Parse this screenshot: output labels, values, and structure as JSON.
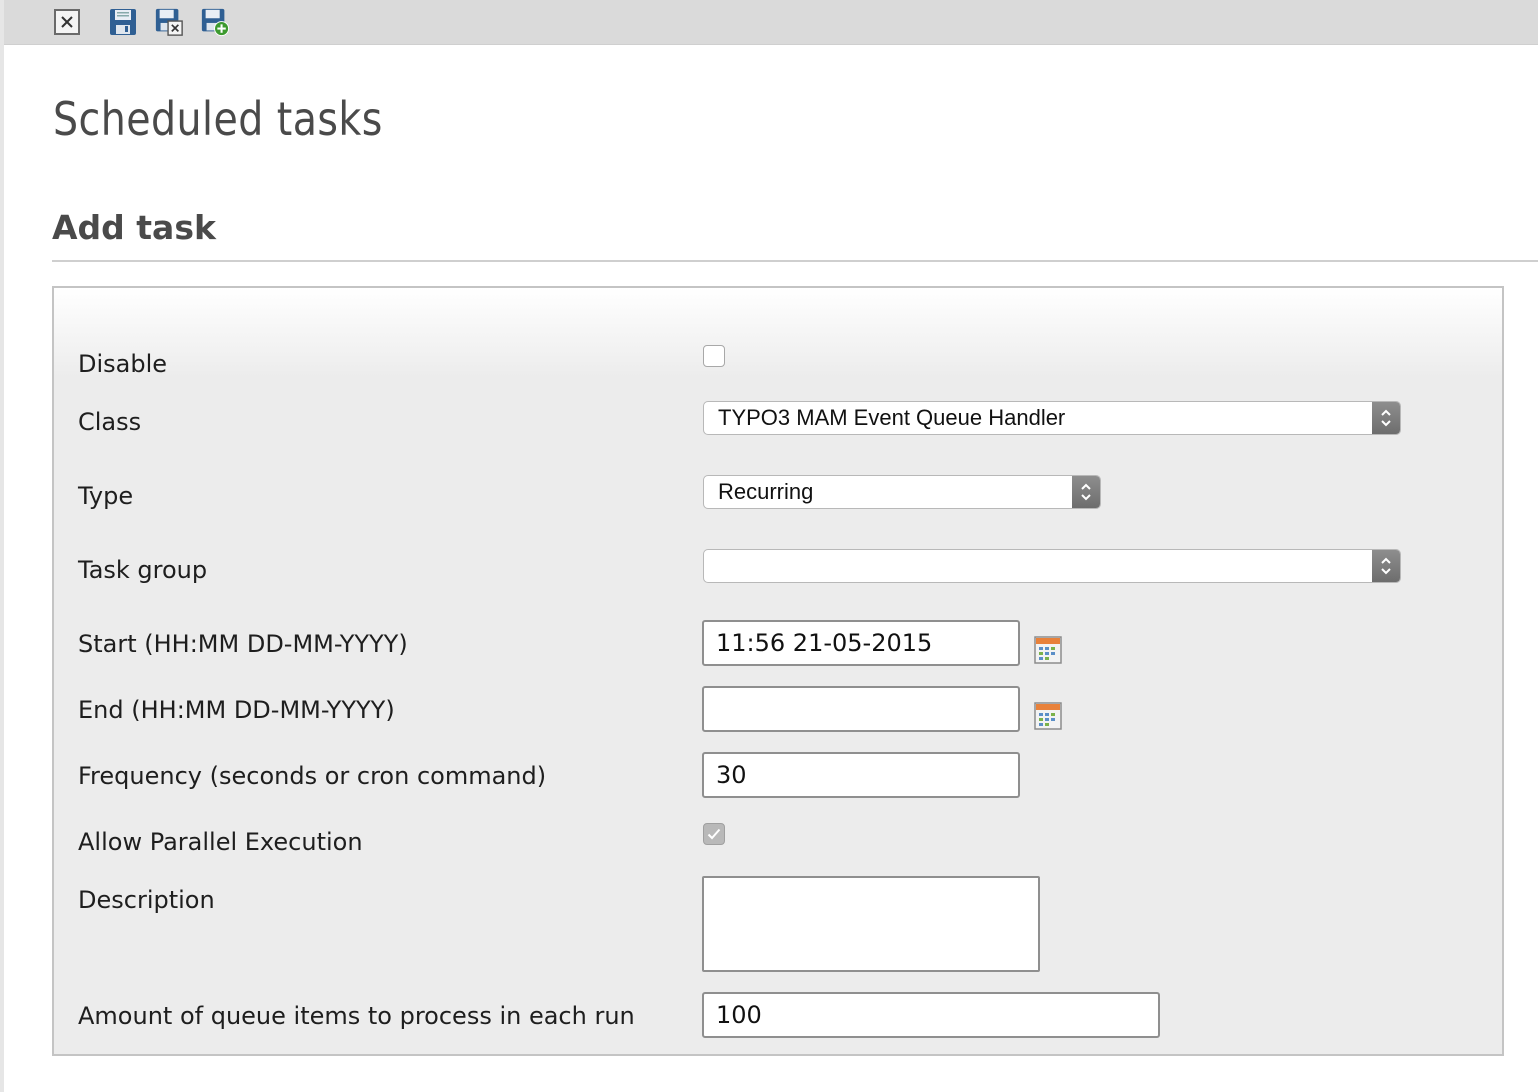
{
  "toolbar": {
    "buttons": [
      {
        "name": "close-button",
        "icon": "close-document-icon"
      },
      {
        "name": "save-button",
        "icon": "save-icon"
      },
      {
        "name": "save-and-close-button",
        "icon": "save-close-icon"
      },
      {
        "name": "save-and-new-button",
        "icon": "save-new-icon"
      }
    ]
  },
  "page": {
    "title": "Scheduled tasks",
    "section_title": "Add task"
  },
  "form": {
    "disable": {
      "label": "Disable",
      "checked": false
    },
    "class": {
      "label": "Class",
      "value": "TYPO3 MAM Event Queue Handler"
    },
    "type": {
      "label": "Type",
      "value": "Recurring"
    },
    "task_group": {
      "label": "Task group",
      "value": ""
    },
    "start": {
      "label": "Start (HH:MM DD-MM-YYYY)",
      "value": "11:56 21-05-2015"
    },
    "end": {
      "label": "End (HH:MM DD-MM-YYYY)",
      "value": ""
    },
    "frequency": {
      "label": "Frequency (seconds or cron command)",
      "value": "30"
    },
    "parallel": {
      "label": "Allow Parallel Execution",
      "checked": true
    },
    "description": {
      "label": "Description",
      "value": ""
    },
    "queue_items": {
      "label": "Amount of queue items to process in each run",
      "value": "100"
    }
  },
  "colors": {
    "toolbar_bg": "#dadada",
    "form_bg": "#ececec",
    "title_text": "#4a4a4a",
    "icon_blue": "#2f5f93",
    "icon_green": "#3d9a2f"
  }
}
